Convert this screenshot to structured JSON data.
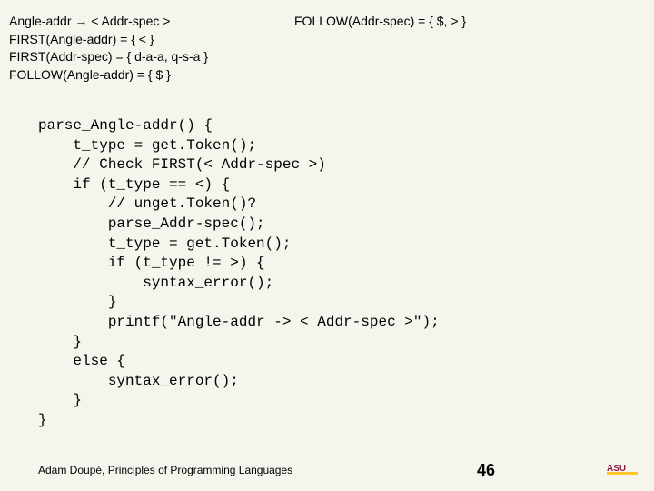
{
  "grammar": {
    "rule": "Angle-addr → < Addr-spec >",
    "first_angle": "FIRST(Angle-addr) = { < }",
    "first_spec": "FIRST(Addr-spec) = { d-a-a, q-s-a }",
    "follow_angle": "FOLLOW(Angle-addr) = { $ }"
  },
  "follow_spec": "FOLLOW(Addr-spec) = { $, > }",
  "code": "parse_Angle-addr() {\n    t_type = get.Token();\n    // Check FIRST(< Addr-spec >)\n    if (t_type == <) {\n        // unget.Token()?\n        parse_Addr-spec();\n        t_type = get.Token();\n        if (t_type != >) {\n            syntax_error();\n        }\n        printf(\"Angle-addr -> < Addr-spec >\");\n    }\n    else {\n        syntax_error();\n    }\n}",
  "footer": "Adam Doupé, Principles of Programming Languages",
  "page": "46"
}
